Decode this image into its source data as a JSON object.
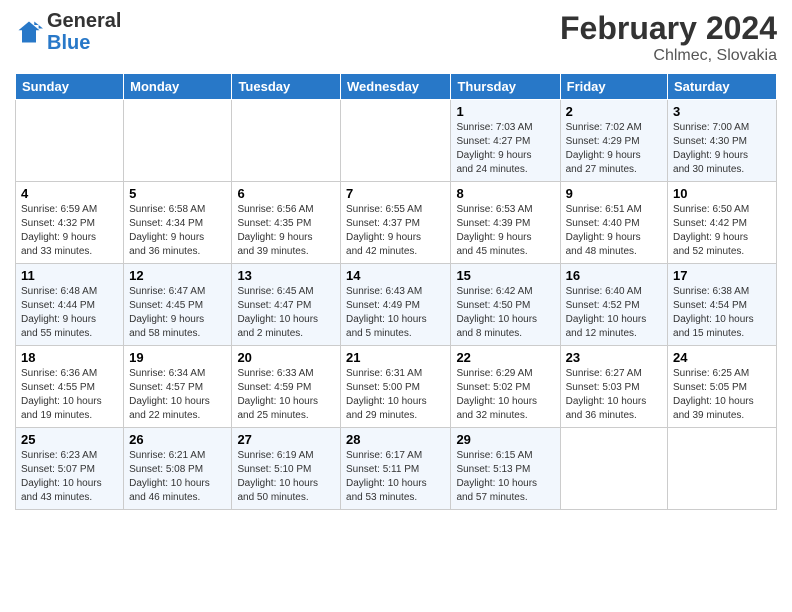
{
  "header": {
    "logo_line1": "General",
    "logo_line2": "Blue",
    "title": "February 2024",
    "subtitle": "Chlmec, Slovakia"
  },
  "weekdays": [
    "Sunday",
    "Monday",
    "Tuesday",
    "Wednesday",
    "Thursday",
    "Friday",
    "Saturday"
  ],
  "weeks": [
    [
      {
        "num": "",
        "info": ""
      },
      {
        "num": "",
        "info": ""
      },
      {
        "num": "",
        "info": ""
      },
      {
        "num": "",
        "info": ""
      },
      {
        "num": "1",
        "info": "Sunrise: 7:03 AM\nSunset: 4:27 PM\nDaylight: 9 hours\nand 24 minutes."
      },
      {
        "num": "2",
        "info": "Sunrise: 7:02 AM\nSunset: 4:29 PM\nDaylight: 9 hours\nand 27 minutes."
      },
      {
        "num": "3",
        "info": "Sunrise: 7:00 AM\nSunset: 4:30 PM\nDaylight: 9 hours\nand 30 minutes."
      }
    ],
    [
      {
        "num": "4",
        "info": "Sunrise: 6:59 AM\nSunset: 4:32 PM\nDaylight: 9 hours\nand 33 minutes."
      },
      {
        "num": "5",
        "info": "Sunrise: 6:58 AM\nSunset: 4:34 PM\nDaylight: 9 hours\nand 36 minutes."
      },
      {
        "num": "6",
        "info": "Sunrise: 6:56 AM\nSunset: 4:35 PM\nDaylight: 9 hours\nand 39 minutes."
      },
      {
        "num": "7",
        "info": "Sunrise: 6:55 AM\nSunset: 4:37 PM\nDaylight: 9 hours\nand 42 minutes."
      },
      {
        "num": "8",
        "info": "Sunrise: 6:53 AM\nSunset: 4:39 PM\nDaylight: 9 hours\nand 45 minutes."
      },
      {
        "num": "9",
        "info": "Sunrise: 6:51 AM\nSunset: 4:40 PM\nDaylight: 9 hours\nand 48 minutes."
      },
      {
        "num": "10",
        "info": "Sunrise: 6:50 AM\nSunset: 4:42 PM\nDaylight: 9 hours\nand 52 minutes."
      }
    ],
    [
      {
        "num": "11",
        "info": "Sunrise: 6:48 AM\nSunset: 4:44 PM\nDaylight: 9 hours\nand 55 minutes."
      },
      {
        "num": "12",
        "info": "Sunrise: 6:47 AM\nSunset: 4:45 PM\nDaylight: 9 hours\nand 58 minutes."
      },
      {
        "num": "13",
        "info": "Sunrise: 6:45 AM\nSunset: 4:47 PM\nDaylight: 10 hours\nand 2 minutes."
      },
      {
        "num": "14",
        "info": "Sunrise: 6:43 AM\nSunset: 4:49 PM\nDaylight: 10 hours\nand 5 minutes."
      },
      {
        "num": "15",
        "info": "Sunrise: 6:42 AM\nSunset: 4:50 PM\nDaylight: 10 hours\nand 8 minutes."
      },
      {
        "num": "16",
        "info": "Sunrise: 6:40 AM\nSunset: 4:52 PM\nDaylight: 10 hours\nand 12 minutes."
      },
      {
        "num": "17",
        "info": "Sunrise: 6:38 AM\nSunset: 4:54 PM\nDaylight: 10 hours\nand 15 minutes."
      }
    ],
    [
      {
        "num": "18",
        "info": "Sunrise: 6:36 AM\nSunset: 4:55 PM\nDaylight: 10 hours\nand 19 minutes."
      },
      {
        "num": "19",
        "info": "Sunrise: 6:34 AM\nSunset: 4:57 PM\nDaylight: 10 hours\nand 22 minutes."
      },
      {
        "num": "20",
        "info": "Sunrise: 6:33 AM\nSunset: 4:59 PM\nDaylight: 10 hours\nand 25 minutes."
      },
      {
        "num": "21",
        "info": "Sunrise: 6:31 AM\nSunset: 5:00 PM\nDaylight: 10 hours\nand 29 minutes."
      },
      {
        "num": "22",
        "info": "Sunrise: 6:29 AM\nSunset: 5:02 PM\nDaylight: 10 hours\nand 32 minutes."
      },
      {
        "num": "23",
        "info": "Sunrise: 6:27 AM\nSunset: 5:03 PM\nDaylight: 10 hours\nand 36 minutes."
      },
      {
        "num": "24",
        "info": "Sunrise: 6:25 AM\nSunset: 5:05 PM\nDaylight: 10 hours\nand 39 minutes."
      }
    ],
    [
      {
        "num": "25",
        "info": "Sunrise: 6:23 AM\nSunset: 5:07 PM\nDaylight: 10 hours\nand 43 minutes."
      },
      {
        "num": "26",
        "info": "Sunrise: 6:21 AM\nSunset: 5:08 PM\nDaylight: 10 hours\nand 46 minutes."
      },
      {
        "num": "27",
        "info": "Sunrise: 6:19 AM\nSunset: 5:10 PM\nDaylight: 10 hours\nand 50 minutes."
      },
      {
        "num": "28",
        "info": "Sunrise: 6:17 AM\nSunset: 5:11 PM\nDaylight: 10 hours\nand 53 minutes."
      },
      {
        "num": "29",
        "info": "Sunrise: 6:15 AM\nSunset: 5:13 PM\nDaylight: 10 hours\nand 57 minutes."
      },
      {
        "num": "",
        "info": ""
      },
      {
        "num": "",
        "info": ""
      }
    ]
  ],
  "colors": {
    "header_bg": "#2878c8",
    "row_odd": "#f2f7fd",
    "row_even": "#ffffff"
  }
}
